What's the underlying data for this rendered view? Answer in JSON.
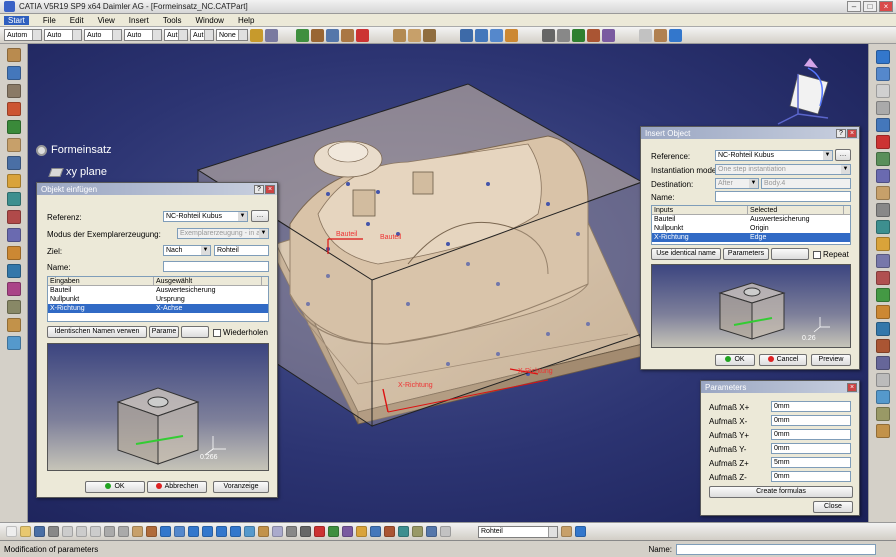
{
  "window": {
    "title": "CATIA V5R19 SP9 x64 Daimler AG - [Formeinsatz_NC.CATPart]"
  },
  "menu": [
    "Start",
    "File",
    "Edit",
    "View",
    "Insert",
    "Tools",
    "Window",
    "Help"
  ],
  "toolbar": {
    "combos": [
      "Autom",
      "Auto",
      "Auto",
      "Auto",
      "Aut",
      "Aut",
      "None"
    ]
  },
  "tree": {
    "root": "Formeinsatz",
    "child": "xy plane"
  },
  "dialog_de": {
    "title": "Objekt einfügen",
    "referenz_label": "Referenz:",
    "referenz_value": "NC-Rohteil Kubus",
    "modus_label": "Modus der Exemplarerzeugung:",
    "modus_value": "Exemplarerzeugung - in al",
    "ziel_label": "Ziel:",
    "ziel_value": "Nach",
    "ziel_target": "Rohteil",
    "name_label": "Name:",
    "name_value": "",
    "col_eingaben": "Eingaben",
    "col_ausgewaehlt": "Ausgewählt",
    "rows": [
      {
        "input": "Bauteil",
        "selected": "Auswertesicherung"
      },
      {
        "input": "Nullpunkt",
        "selected": "Ursprung"
      },
      {
        "input": "X-Richtung",
        "selected": "X-Achse"
      }
    ],
    "btn_identische": "Identischen Namen verwen",
    "btn_parameter": "Parame",
    "chk_wiederholen": "Wiederholen",
    "preview_value": "0.266",
    "btn_ok": "OK",
    "btn_abbrechen": "Abbrechen",
    "btn_voranzeige": "Voranzeige"
  },
  "dialog_en": {
    "title": "Insert Object",
    "reference_label": "Reference:",
    "reference_value": "NC-Rohteil Kubus",
    "mode_label": "Instantiation mode:",
    "mode_value": "One step instantiation",
    "dest_label": "Destination:",
    "dest_value": "After",
    "dest_target": "Body.4",
    "name_label": "Name:",
    "name_value": "",
    "col_inputs": "Inputs",
    "col_selected": "Selected",
    "rows": [
      {
        "input": "Bauteil",
        "selected": "Auswertesicherung"
      },
      {
        "input": "Nullpunkt",
        "selected": "Origin"
      },
      {
        "input": "X-Richtung",
        "selected": "Edge"
      }
    ],
    "btn_identical": "Use identical name",
    "btn_parameters": "Parameters",
    "chk_repeat": "Repeat",
    "preview_value": "0.26",
    "btn_ok": "OK",
    "btn_cancel": "Cancel",
    "btn_preview": "Preview"
  },
  "parameters": {
    "title": "Parameters",
    "rows": [
      {
        "label": "Aufmaß X+",
        "value": "0mm"
      },
      {
        "label": "Aufmaß X-",
        "value": "0mm"
      },
      {
        "label": "Aufmaß Y+",
        "value": "0mm"
      },
      {
        "label": "Aufmaß Y-",
        "value": "0mm"
      },
      {
        "label": "Aufmaß Z+",
        "value": "5mm"
      },
      {
        "label": "Aufmaß Z-",
        "value": "0mm"
      }
    ],
    "btn_create": "Create formulas",
    "btn_close": "Close"
  },
  "annotations": {
    "bauteil1": "Bauteil",
    "bauteil2": "Bauteil",
    "x_richtung1": "X-Richtung",
    "x_richtung2": "X-Richtung"
  },
  "bottombar": {
    "combo_value": "Rohteil"
  },
  "status": {
    "message": "Modification of parameters",
    "name_label": "Name:"
  },
  "colors": {
    "viewport": "#2c3472",
    "selection": "#316ac5",
    "part": "#d9c3a8"
  }
}
